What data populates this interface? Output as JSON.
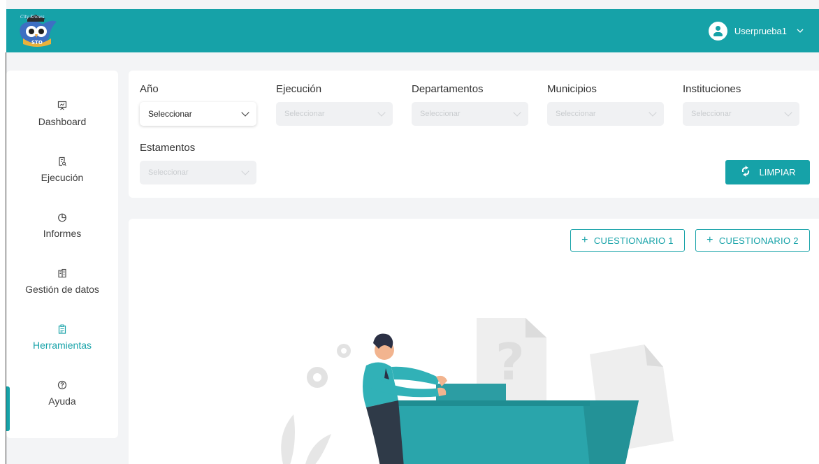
{
  "header": {
    "logo_icon": "owl-logo-icon",
    "user_name": "Userprueba1",
    "brand_color": "#16a2a8"
  },
  "sidebar": {
    "items": [
      {
        "label": "Dashboard",
        "icon": "presentation-icon",
        "active": false
      },
      {
        "label": "Ejecución",
        "icon": "document-search-icon",
        "active": false
      },
      {
        "label": "Informes",
        "icon": "pie-chart-icon",
        "active": false
      },
      {
        "label": "Gestión de datos",
        "icon": "building-icon",
        "active": false
      },
      {
        "label": "Herramientas",
        "icon": "clipboard-icon",
        "active": true
      },
      {
        "label": "Ayuda",
        "icon": "help-circle-icon",
        "active": false
      }
    ]
  },
  "filters": {
    "fields": [
      {
        "label": "Año",
        "value": "Seleccionar",
        "enabled": true
      },
      {
        "label": "Ejecución",
        "value": "Seleccionar",
        "enabled": false
      },
      {
        "label": "Departamentos",
        "value": "Seleccionar",
        "enabled": false
      },
      {
        "label": "Municipios",
        "value": "Seleccionar",
        "enabled": false
      },
      {
        "label": "Instituciones",
        "value": "Seleccionar",
        "enabled": false
      },
      {
        "label": "Estamentos",
        "value": "Seleccionar",
        "enabled": false
      }
    ],
    "clear_button": "LIMPIAR"
  },
  "content": {
    "buttons": [
      {
        "label": "CUESTIONARIO 1",
        "icon": "plus-icon"
      },
      {
        "label": "CUESTIONARIO 2",
        "icon": "plus-icon"
      }
    ],
    "illustration": "empty-state-illustration"
  }
}
